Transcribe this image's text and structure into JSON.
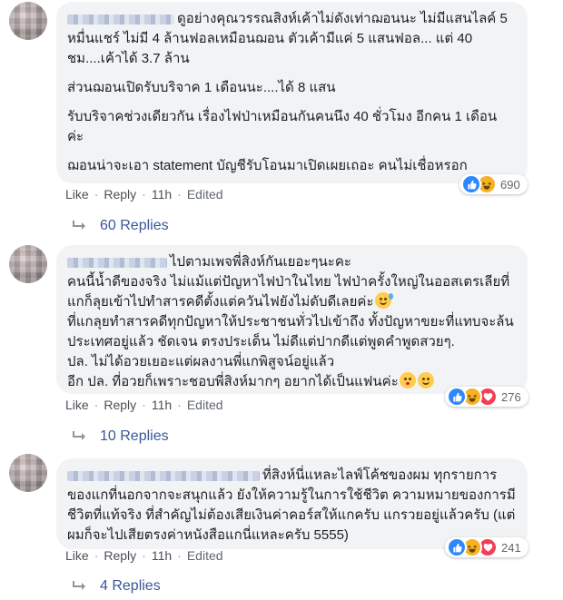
{
  "comments": [
    {
      "paragraphs": [
        "ดูอย่างคุณวรรณสิงห์เค้าไม่ดังเท่าฌอนนะ ไม่มีแสนไลค์ 5 หมื่นแชร์ ไม่มี 4 ล้านฟอลเหมือนฌอน ตัวเค้ามีแค่ 5 แสนฟอล... แต่ 40 ชม....เค้าได้ 3.7 ล้าน",
        "ส่วนฌอนเปิดรับบริจาค 1 เดือนนะ....ได้ 8 แสน",
        "รับบริจาคช่วงเดียวกัน เรื่องไฟป่าเหมือนกันคนนึง 40 ชั่วโมง อีกคน 1 เดือน ค่ะ",
        "ฌอนน่าจะเอา statement บัญชีรับโอนมาเปิดเผยเถอะ คนไม่เชื่อหรอก"
      ],
      "like": "Like",
      "reply": "Reply",
      "time": "11h",
      "edited": "Edited",
      "reaction_count": "690",
      "replies": "60 Replies"
    },
    {
      "paragraphs": [
        "ไปตามเพจพี่สิงห์กันเยอะๆนะคะ\nคนนี้น้ำดีของจริง ไม่แม้แต่ปัญหาไฟป่าในไทย ไฟป่าครั้งใหญ่ในออสเตรเลียที่แกก็ลุยเข้าไปทำสารคดีตั้งแต่ควันไฟยังไม่ดับดีเลยค่ะ",
        "ที่แกลุยทำสารคดีทุกปัญหาให้ประชาชนทั่วไปเข้าถึง ทั้งปัญหาขยะที่แทบจะล้นประเทศอยู่แล้ว ชัดเจน ตรงประเด็น ไม่ดีแต่ปากดีแต่พูดคำพูดสวยๆ.\nปล. ไม่ได้อวยเยอะแต่ผลงานพี่แกพิสูจน์อยู่แล้ว\nอีก ปล. ที่อวยก็เพราะชอบพี่สิงห์มากๆ อยากได้เป็นแฟนค่ะ"
      ],
      "like": "Like",
      "reply": "Reply",
      "time": "11h",
      "edited": "Edited",
      "reaction_count": "276",
      "replies": "10 Replies"
    },
    {
      "paragraphs": [
        "ที่สิงห์นี่แหละไลฟ์โค้ชของผม ทุกรายการของแกที่นอกจากจะสนุกแล้ว ยังให้ความรู้ในการใช้ชีวิต ความหมายของการมีชีวิตที่แท้จริง ที่สำคัญไม่ต้องเสียเงินค่าคอร์สให้แกครับ แกรวยอยู่แล้วครับ (แต่ผมก็จะไปเสียตรงค่าหนังสือแกนี่แหละครับ 5555)"
      ],
      "like": "Like",
      "reply": "Reply",
      "time": "11h",
      "edited": "Edited",
      "reaction_count": "241",
      "replies": "4 Replies"
    }
  ],
  "colors": {
    "bubble": "#f2f3f5",
    "link": "#385898",
    "like": "#2d88ff",
    "haha": "#f7b125",
    "love": "#f33e58"
  },
  "icons": [
    "like-reaction-icon",
    "haha-reaction-icon",
    "love-reaction-icon",
    "reply-arrow-icon",
    "grin-sweat-emoji",
    "kiss-emoji",
    "laughing-emoji"
  ]
}
